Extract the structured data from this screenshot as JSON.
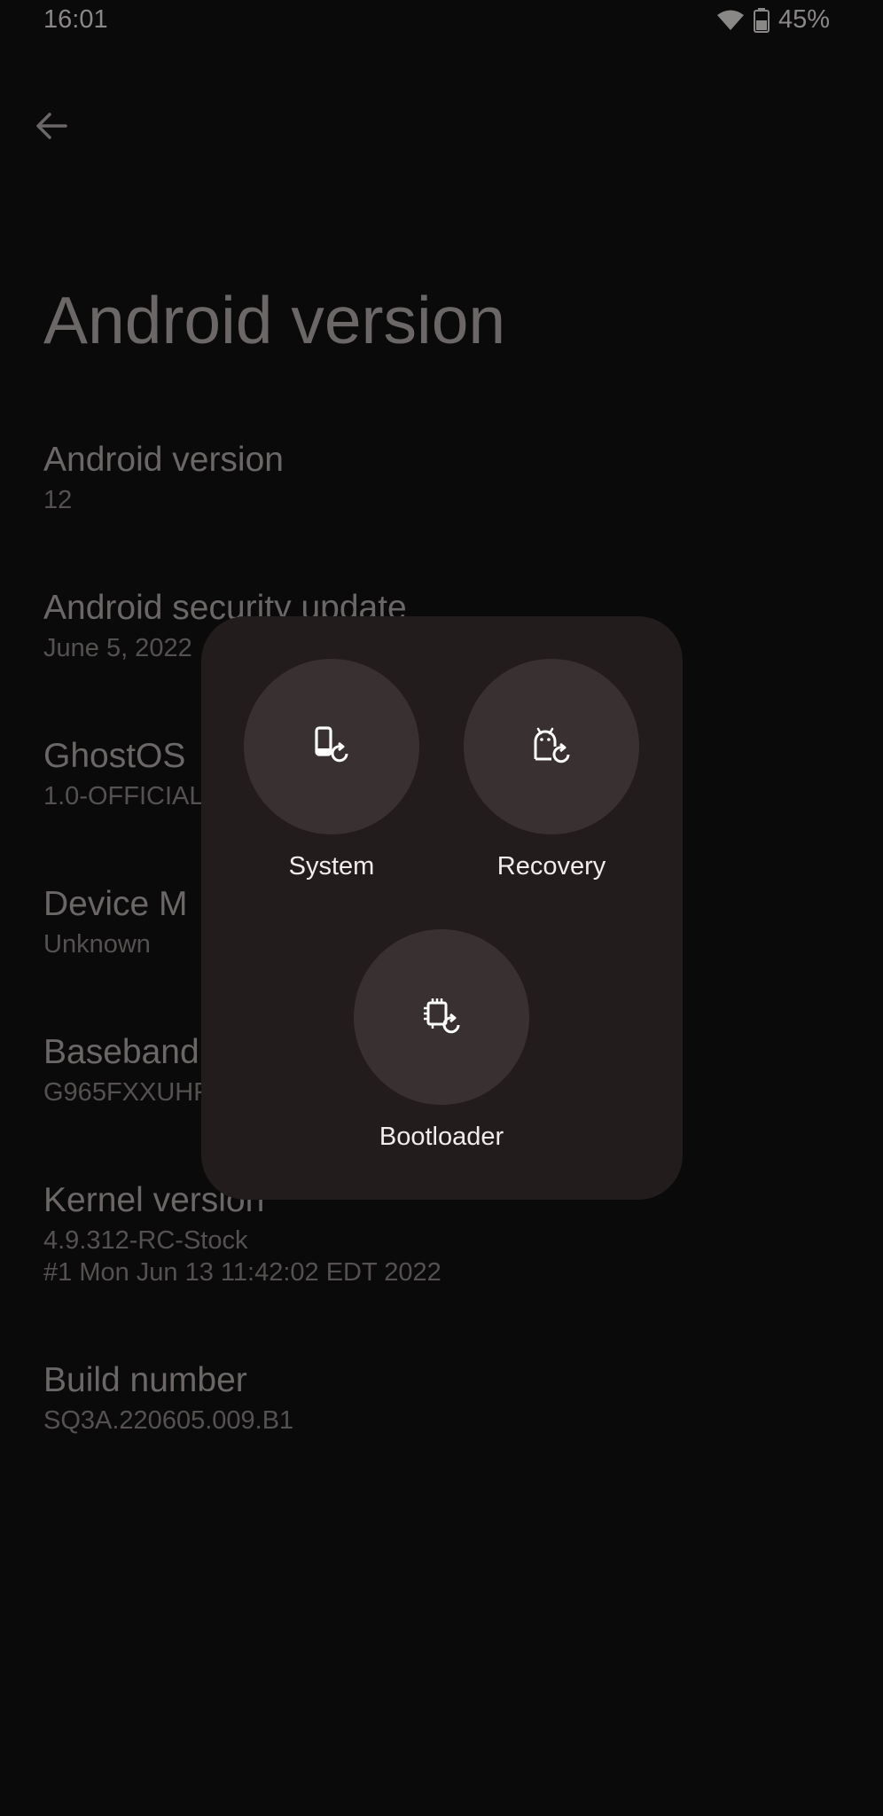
{
  "status_bar": {
    "time": "16:01",
    "battery": "45%",
    "icons": [
      "wifi-icon",
      "battery-icon"
    ]
  },
  "app_bar": {
    "back_icon": "arrow-back-icon",
    "title": "Android version"
  },
  "items": [
    {
      "title": "Android version",
      "summary": "12"
    },
    {
      "title": "Android security update",
      "summary": "June 5, 2022"
    },
    {
      "title": "GhostOS",
      "summary": "1.0-OFFICIAL"
    },
    {
      "title": "Device M",
      "summary": "Unknown"
    },
    {
      "title": "Baseband",
      "summary": "G965FXXUHF"
    },
    {
      "title": "Kernel version",
      "summary": "4.9.312-RC-Stock\n#1 Mon Jun 13 11:42:02 EDT 2022"
    },
    {
      "title": "Build number",
      "summary": "SQ3A.220605.009.B1"
    }
  ],
  "reboot_dialog": {
    "options": [
      {
        "label": "System",
        "icon": "phone-restart-icon"
      },
      {
        "label": "Recovery",
        "icon": "android-restart-icon"
      },
      {
        "label": "Bootloader",
        "icon": "chip-restart-icon"
      }
    ]
  },
  "colors": {
    "background": "#0b0a0a",
    "dialog": "#221c1c",
    "button_circle": "#393131",
    "label": "#f1eded"
  }
}
